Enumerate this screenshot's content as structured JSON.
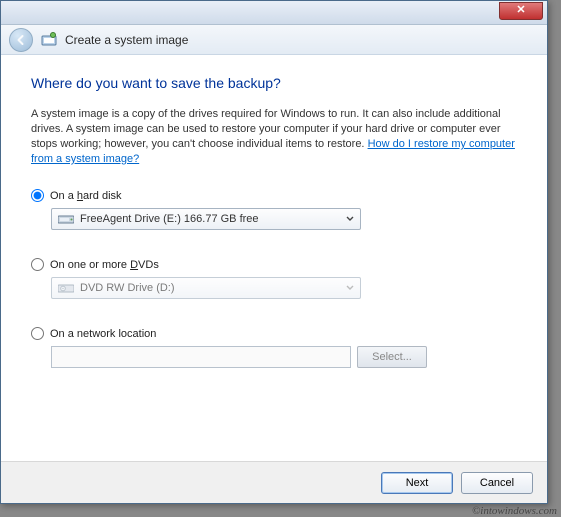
{
  "window": {
    "title": "Create a system image"
  },
  "page": {
    "heading": "Where do you want to save the backup?",
    "description_pre": "A system image is a copy of the drives required for Windows to run. It can also include additional drives. A system image can be used to restore your computer if your hard drive or computer ever stops working; however, you can't choose individual items to restore. ",
    "help_link": "How do I restore my computer from a system image?"
  },
  "options": {
    "hard_disk": {
      "label_pre": "On a ",
      "label_key": "h",
      "label_post": "ard disk",
      "selected": "FreeAgent Drive (E:)  166.77 GB free",
      "checked": true
    },
    "dvd": {
      "label_pre": "On one or more ",
      "label_key": "D",
      "label_post": "VDs",
      "selected": "DVD RW Drive (D:)",
      "checked": false
    },
    "network": {
      "label": "On a network location",
      "value": "",
      "select_btn": "Select...",
      "checked": false
    }
  },
  "footer": {
    "next": "Next",
    "cancel": "Cancel"
  },
  "watermark": "©intowindows.com"
}
